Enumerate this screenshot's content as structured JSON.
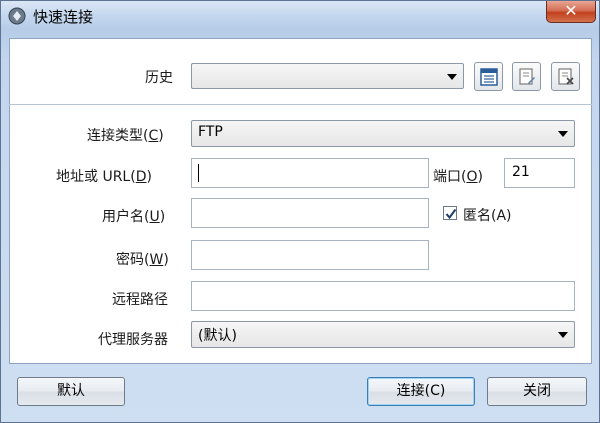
{
  "window": {
    "title": "快速连接",
    "close_label": "✕"
  },
  "history": {
    "label": "历史",
    "value": ""
  },
  "form": {
    "connection_type": {
      "label": "连接类型(",
      "key": "C",
      "tail": ")",
      "value": "FTP"
    },
    "address": {
      "label": "地址或 URL(",
      "key": "D",
      "tail": ")",
      "value": ""
    },
    "port": {
      "label": "端口(",
      "key": "O",
      "tail": ")",
      "value": "21"
    },
    "username": {
      "label": "用户名(",
      "key": "U",
      "tail": ")",
      "value": ""
    },
    "anonymous": {
      "label": "匿名(A)",
      "checked": true
    },
    "password": {
      "label": "密码(",
      "key": "W",
      "tail": ")",
      "value": ""
    },
    "remote_path": {
      "label": "远程路径",
      "value": ""
    },
    "proxy": {
      "label": "代理服务器",
      "value": "(默认)"
    }
  },
  "buttons": {
    "default_label": "默认",
    "connect_label": "连接(C)",
    "close_label": "关闭"
  }
}
